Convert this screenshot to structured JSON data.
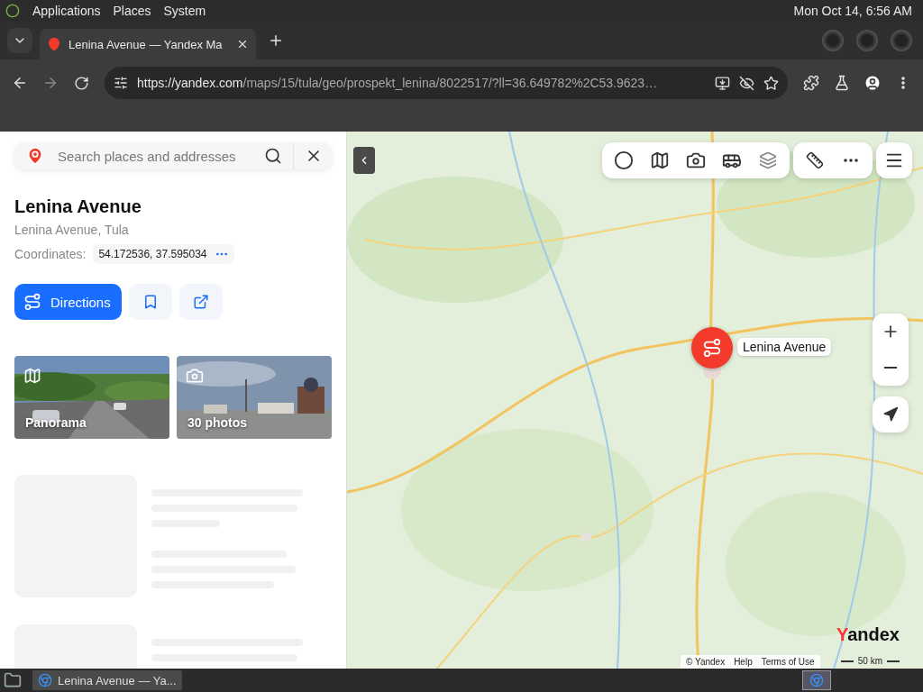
{
  "desktop_panel": {
    "menus": [
      "Applications",
      "Places",
      "System"
    ],
    "clock": "Mon Oct 14,  6:56 AM"
  },
  "browser": {
    "tabs": [
      {
        "title": "Lenina Avenue — Yandex Ma",
        "selected": true
      }
    ],
    "url": {
      "host": "https://yandex.com",
      "path": "/maps/15/tula/geo/prospekt_lenina/8022517/?ll=36.649782%2C53.9623…"
    }
  },
  "sidebar": {
    "search": {
      "placeholder": "Search places and addresses"
    },
    "place": {
      "title": "Lenina Avenue",
      "address": "Lenina Avenue, Tula",
      "coordinates_label": "Coordinates:",
      "coordinates": "54.172536, 37.595034"
    },
    "actions": {
      "directions": "Directions"
    },
    "media": [
      {
        "kind": "panorama",
        "label": "Panorama"
      },
      {
        "kind": "photos",
        "label": "30 photos"
      }
    ]
  },
  "map": {
    "marker_label": "Lenina Avenue",
    "logo": "Yandex",
    "attribution": [
      "© Yandex",
      "Help",
      "Terms of Use"
    ],
    "scale": "50 km"
  },
  "taskbar": {
    "windows": [
      {
        "title": "Lenina Avenue — Ya...",
        "selected": true
      }
    ]
  }
}
